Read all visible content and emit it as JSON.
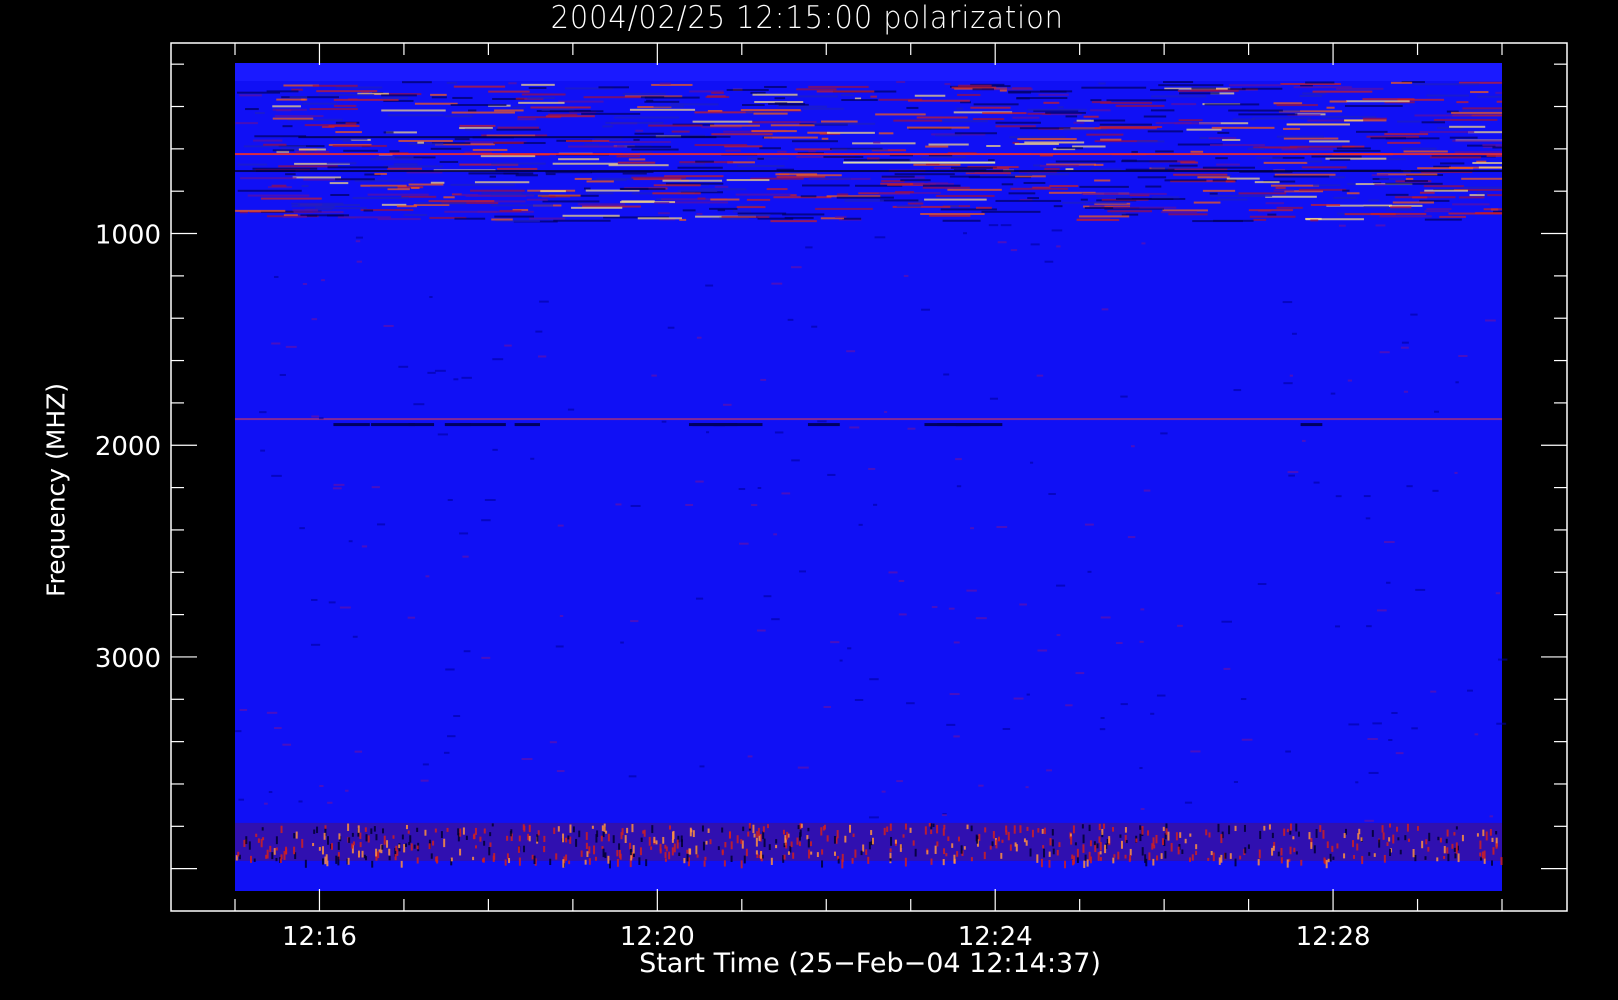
{
  "chart_data": {
    "type": "heatmap",
    "title": "2004/02/25 12:15:00 polarization",
    "xlabel": "Start Time (25−Feb−04 12:14:37)",
    "ylabel": "Frequency (MHZ)",
    "x_ticks": [
      {
        "label": "12:16",
        "value_min": 16
      },
      {
        "label": "12:20",
        "value_min": 20
      },
      {
        "label": "12:24",
        "value_min": 24
      },
      {
        "label": "12:28",
        "value_min": 28
      }
    ],
    "xlim_minutes": [
      15,
      30
    ],
    "y_ticks": [
      {
        "label": "1000",
        "value": 1000
      },
      {
        "label": "2000",
        "value": 2000
      },
      {
        "label": "3000",
        "value": 3000
      }
    ],
    "ylim": [
      4200,
      100
    ],
    "y_inverted": true,
    "data_frequency_range": [
      190,
      3990
    ],
    "colormap": {
      "low": "#000000",
      "mid": "#0000ff",
      "high_red": "#ff0000",
      "peak": "#ffff80"
    },
    "background_color": "#1010f5",
    "noted_features": [
      {
        "frequency_mhz": 1900,
        "description": "horizontal band"
      },
      {
        "frequency_mhz": 3850,
        "description": "bright band near bottom"
      }
    ]
  }
}
